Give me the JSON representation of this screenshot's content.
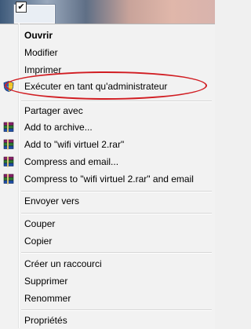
{
  "context_menu": {
    "items": {
      "open": "Ouvrir",
      "edit": "Modifier",
      "print": "Imprimer",
      "run_as_admin": "Exécuter en tant qu'administrateur",
      "share_with": "Partager avec",
      "add_to_archive": "Add to archive...",
      "add_to_rar": "Add to \"wifi virtuel 2.rar\"",
      "compress_email": "Compress and email...",
      "compress_rar_email": "Compress to \"wifi virtuel 2.rar\" and email",
      "send_to": "Envoyer vers",
      "cut": "Couper",
      "copy": "Copier",
      "create_shortcut": "Créer un raccourci",
      "delete": "Supprimer",
      "rename": "Renommer",
      "properties": "Propriétés"
    }
  },
  "file_icon": {
    "checked": "✔"
  },
  "colors": {
    "highlight_ellipse": "#d11d22",
    "menu_bg": "#f2f2f2"
  },
  "icons": {
    "run_as_admin": "uac-shield-icon",
    "archive": "winrar-books-icon"
  }
}
